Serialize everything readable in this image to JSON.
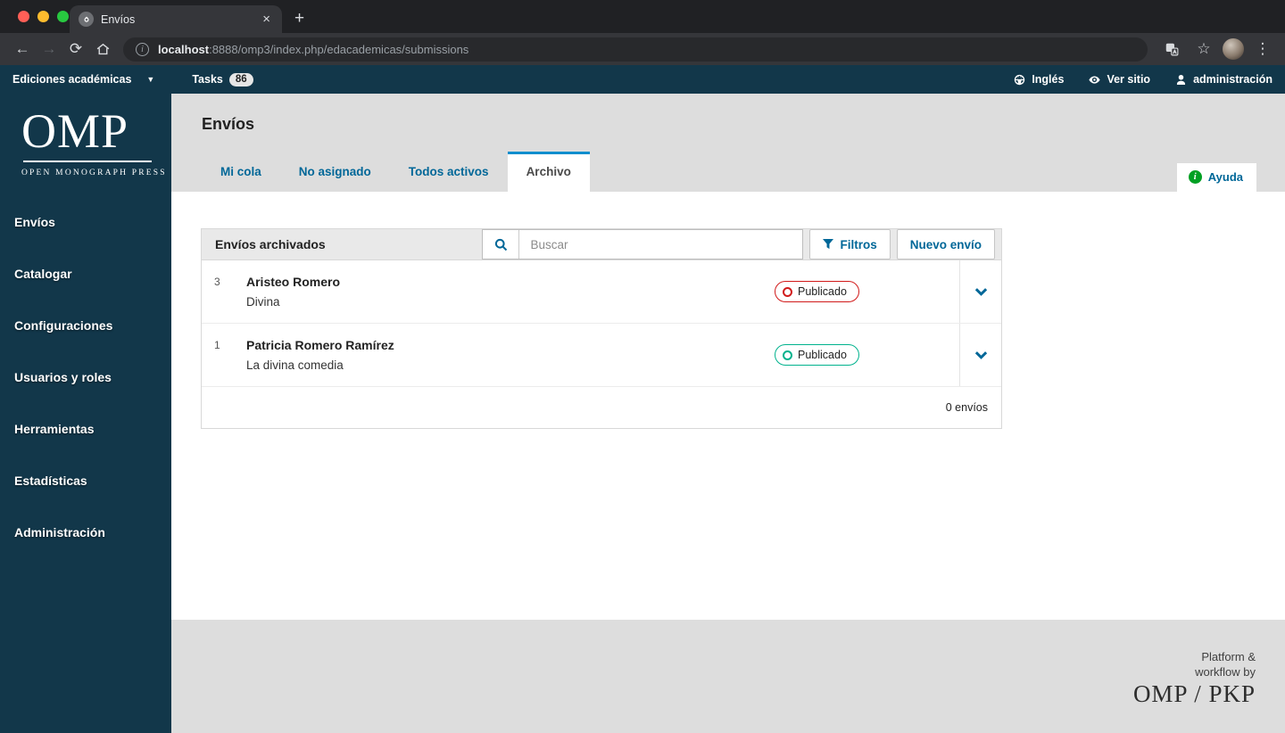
{
  "browser": {
    "tab_title": "Envíos",
    "new_tab_label": "+",
    "close_label": "×",
    "url_host": "localhost",
    "url_rest": ":8888/omp3/index.php/edacademicas/submissions"
  },
  "topbar": {
    "context": "Ediciones académicas",
    "tasks_label": "Tasks",
    "tasks_count": "86",
    "language": "Inglés",
    "view_site": "Ver sitio",
    "user": "administración"
  },
  "sidebar": {
    "logo_main": "OMP",
    "logo_sub": "OPEN MONOGRAPH PRESS",
    "items": [
      {
        "label": "Envíos"
      },
      {
        "label": "Catalogar"
      },
      {
        "label": "Configuraciones"
      },
      {
        "label": "Usuarios y roles"
      },
      {
        "label": "Herramientas"
      },
      {
        "label": "Estadísticas"
      },
      {
        "label": "Administración"
      }
    ]
  },
  "page": {
    "title": "Envíos",
    "tabs": [
      {
        "label": "Mi cola"
      },
      {
        "label": "No asignado"
      },
      {
        "label": "Todos activos"
      },
      {
        "label": "Archivo"
      }
    ],
    "help_label": "Ayuda"
  },
  "panel": {
    "title": "Envíos archivados",
    "search_placeholder": "Buscar",
    "filters_label": "Filtros",
    "new_submission_label": "Nuevo envío",
    "rows": [
      {
        "id": "3",
        "author": "Aristeo Romero",
        "title": "Divina",
        "status": "Publicado",
        "status_color": "#d11a1a"
      },
      {
        "id": "1",
        "author": "Patricia Romero Ramírez",
        "title": "La divina comedia",
        "status": "Publicado",
        "status_color": "#00b28d"
      }
    ],
    "footer_count": "0 envíos"
  },
  "footer": {
    "tagline_line1": "Platform &",
    "tagline_line2": "workflow by",
    "brand": "OMP / PKP"
  },
  "colors": {
    "accent_blue": "#006798",
    "active_tab_border": "#0b8dcd",
    "chrome_dark": "#202124",
    "pkp_teal": "#12374a",
    "page_grey": "#dddddd",
    "help_green": "#00a023",
    "status_red": "#d11a1a",
    "status_teal": "#00b28d"
  }
}
